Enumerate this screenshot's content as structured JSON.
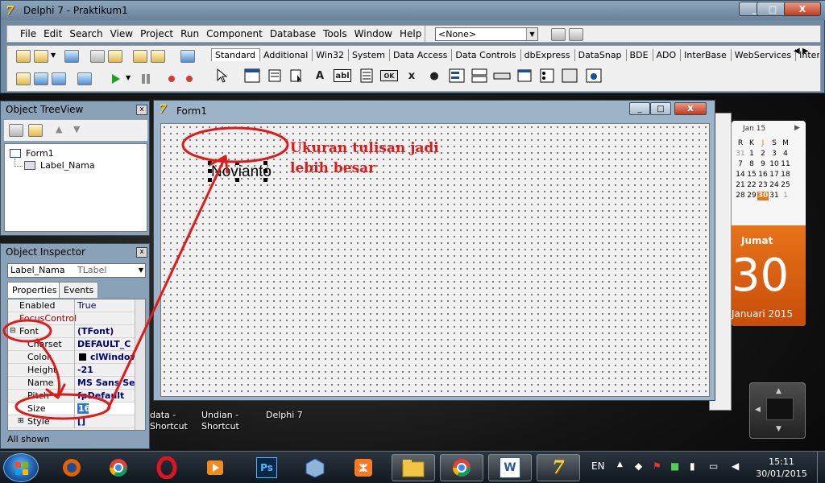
{
  "app": {
    "title": "Delphi 7 - Praktikum1",
    "logo": "7",
    "caption_buttons": [
      "_",
      "□",
      "X"
    ]
  },
  "menubar": {
    "items": [
      "File",
      "Edit",
      "Search",
      "View",
      "Project",
      "Run",
      "Component",
      "Database",
      "Tools",
      "Window",
      "Help"
    ]
  },
  "desktop_select": {
    "value": "<None>"
  },
  "palette": {
    "tabs": [
      "Standard",
      "Additional",
      "Win32",
      "System",
      "Data Access",
      "Data Controls",
      "dbExpress",
      "DataSnap",
      "BDE",
      "ADO",
      "InterBase",
      "WebServices",
      "Intern"
    ],
    "active_tab": "Standard",
    "components": [
      "A",
      "abl",
      "OK",
      "x",
      "●"
    ]
  },
  "treeview": {
    "title": "Object TreeView",
    "root": "Form1",
    "child": "Label_Nama"
  },
  "inspector": {
    "title": "Object Inspector",
    "object_name": "Label_Nama",
    "object_type": "TLabel",
    "tabs": [
      "Properties",
      "Events"
    ],
    "properties": [
      {
        "name": "Enabled",
        "value": "True"
      },
      {
        "name": "FocusControl",
        "value": ""
      },
      {
        "name": "Font",
        "value": "(TFont)"
      },
      {
        "name": "Charset",
        "value": "DEFAULT_C"
      },
      {
        "name": "Color",
        "value": "clWindow"
      },
      {
        "name": "Height",
        "value": "-21"
      },
      {
        "name": "Name",
        "value": "MS Sans Se"
      },
      {
        "name": "Pitch",
        "value": "fpDefault"
      },
      {
        "name": "Size",
        "value": "16"
      },
      {
        "name": "Style",
        "value": "[]"
      }
    ],
    "status": "All shown"
  },
  "form1": {
    "title": "Form1",
    "label_caption": "Novianto"
  },
  "annotation": {
    "text_line1": "Ukuran tulisan jadi",
    "text_line2": "lebih besar",
    "color": "#e01919"
  },
  "calendar": {
    "month_header": "Jan 15",
    "weekday_headers": [
      "R",
      "K",
      "J",
      "S",
      "M"
    ],
    "rows": [
      [
        "31",
        "1",
        "2",
        "3",
        "4"
      ],
      [
        "7",
        "8",
        "9",
        "10",
        "11"
      ],
      [
        "14",
        "15",
        "16",
        "17",
        "18"
      ],
      [
        "21",
        "22",
        "23",
        "24",
        "25"
      ],
      [
        "28",
        "29",
        "30",
        "31",
        "1"
      ]
    ],
    "today": "30",
    "day_name": "Jumat",
    "day_number": "30",
    "month_year": "Januari 2015",
    "accent": "#e8731a"
  },
  "desktop_labels": {
    "icon1_line1": "data -",
    "icon1_line2": "Shortcut",
    "icon2_line1": "Undian -",
    "icon2_line2": "Shortcut",
    "icon3_line1": "Delphi 7"
  },
  "taskbar": {
    "pinned": [
      "windows-media-center",
      "firefox",
      "chrome",
      "opera",
      "media-player",
      "photoshop",
      "virtualbox",
      "xampp",
      "file-explorer",
      "chrome",
      "word",
      "delphi-7"
    ],
    "language": "EN",
    "time": "15:11",
    "date": "30/01/2015"
  }
}
